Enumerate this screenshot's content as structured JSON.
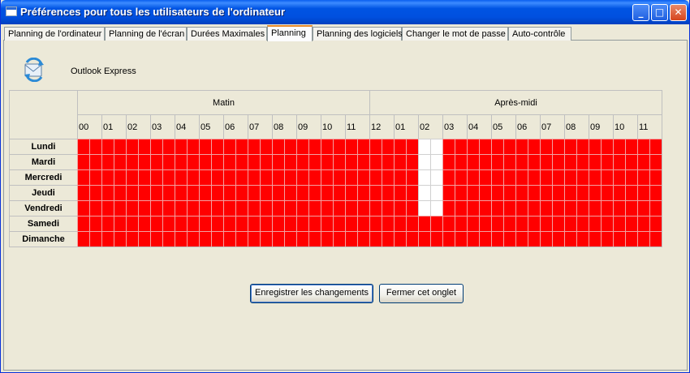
{
  "window": {
    "title": "Préférences pour tous les utilisateurs de l'ordinateur"
  },
  "titlebar_buttons": {
    "minimize": "_",
    "maximize": "□",
    "close": "✕"
  },
  "tabs": [
    {
      "label": "Planning de l'ordinateur",
      "active": false
    },
    {
      "label": "Planning de l'écran",
      "active": false
    },
    {
      "label": "Durées Maximales",
      "active": false
    },
    {
      "label": "Planning",
      "active": true
    },
    {
      "label": "Planning des logiciels",
      "active": false
    },
    {
      "label": "Changer le mot de passe",
      "active": false
    },
    {
      "label": "Auto-contrôle",
      "active": false
    }
  ],
  "app": {
    "name": "Outlook Express",
    "icon": "outlook-express-icon"
  },
  "schedule": {
    "periods": [
      "Matin",
      "Après-midi"
    ],
    "hours": [
      "00",
      "01",
      "02",
      "03",
      "04",
      "05",
      "06",
      "07",
      "08",
      "09",
      "10",
      "11",
      "12",
      "01",
      "02",
      "03",
      "04",
      "05",
      "06",
      "07",
      "08",
      "09",
      "10",
      "11"
    ],
    "slots_per_hour": 2,
    "days": [
      "Lundi",
      "Mardi",
      "Mercredi",
      "Jeudi",
      "Vendredi",
      "Samedi",
      "Dimanche"
    ],
    "allowed_slots_by_day": [
      [
        28,
        29
      ],
      [
        28,
        29
      ],
      [
        28,
        29
      ],
      [
        28,
        29
      ],
      [
        28,
        29
      ],
      [],
      []
    ],
    "colors": {
      "blocked": "#ff0000",
      "allowed": "#ffffff"
    }
  },
  "buttons": {
    "save": "Enregistrer les changements",
    "close_tab": "Fermer cet onglet"
  }
}
